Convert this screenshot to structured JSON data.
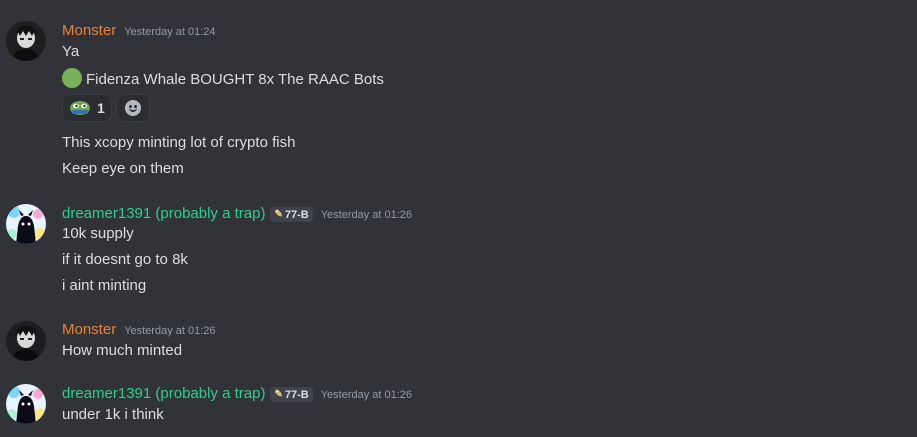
{
  "messages": [
    {
      "author": "Monster",
      "timestamp": "Yesterday at 01:24",
      "lines": [
        "Ya",
        "Fidenza Whale BOUGHT 8x The RAAC Bots"
      ],
      "reactions": [
        {
          "emoji": "pepe-emoji",
          "count": "1"
        }
      ],
      "lines_after": [
        "This xcopy minting lot of crypto fish",
        "Keep eye on them"
      ]
    },
    {
      "author": "dreamer1391 (probably a trap)",
      "tag": "77-B",
      "timestamp": "Yesterday at 01:26",
      "lines": [
        "10k supply",
        "if it doesnt go to 8k",
        "i aint minting"
      ]
    },
    {
      "author": "Monster",
      "timestamp": "Yesterday at 01:26",
      "lines": [
        "How much minted"
      ]
    },
    {
      "author": "dreamer1391 (probably a trap)",
      "tag": "77-B",
      "timestamp": "Yesterday at 01:26",
      "lines": [
        "under 1k i think"
      ]
    }
  ],
  "colors": {
    "background": "#313338",
    "monster_name": "#e8833a",
    "dreamer_name": "#2dcf8f",
    "text": "#dbdee1",
    "timestamp": "#949ba4"
  }
}
